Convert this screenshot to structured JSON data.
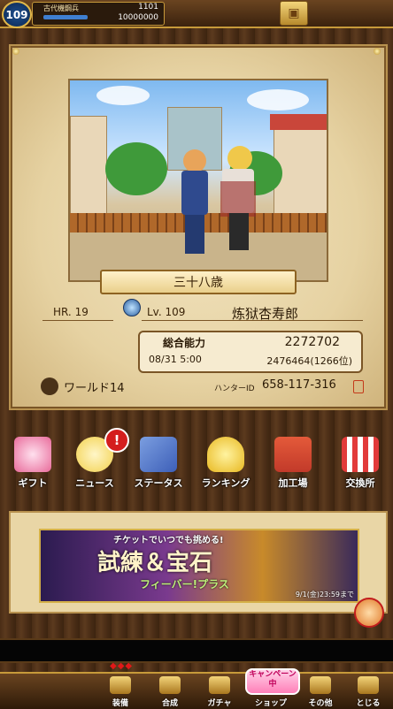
{
  "topbar": {
    "level": "109",
    "title": "古代機鋼兵",
    "currency1": "1101",
    "currency2": "10000000"
  },
  "profile": {
    "age_label": "三十八歳",
    "hr": "HR. 19",
    "lv": "Lv. 109",
    "player_name": "炼狱杏寿郎",
    "power_label": "総合能力",
    "power_value": "2272702",
    "date": "08/31 5:00",
    "rank_value": "2476464(1266位)",
    "world": "ワールド14",
    "hunter_id_label": "ハンターID",
    "hunter_id": "658-117-316"
  },
  "menu": {
    "badge": "!",
    "items": [
      {
        "label": "ギフト",
        "color": "#e86a9a"
      },
      {
        "label": "ニュース",
        "color": "#f2d04a"
      },
      {
        "label": "ステータス",
        "color": "#3d5fb8"
      },
      {
        "label": "ランキング",
        "color": "#e8b820"
      },
      {
        "label": "加工場",
        "color": "#c23a2a"
      },
      {
        "label": "交換所",
        "color": "#d8a030"
      }
    ]
  },
  "event": {
    "top_text": "チケットでいつでも挑める!",
    "main_text": "試練＆宝石",
    "sub_text": "フィーバー!プラス",
    "date_text": "9/1(金)23:59まで"
  },
  "bottom_nav": {
    "campaign": "キャンペーン中",
    "items": [
      "装備",
      "合成",
      "ガチャ",
      "ショップ",
      "その他",
      "とじる"
    ]
  }
}
